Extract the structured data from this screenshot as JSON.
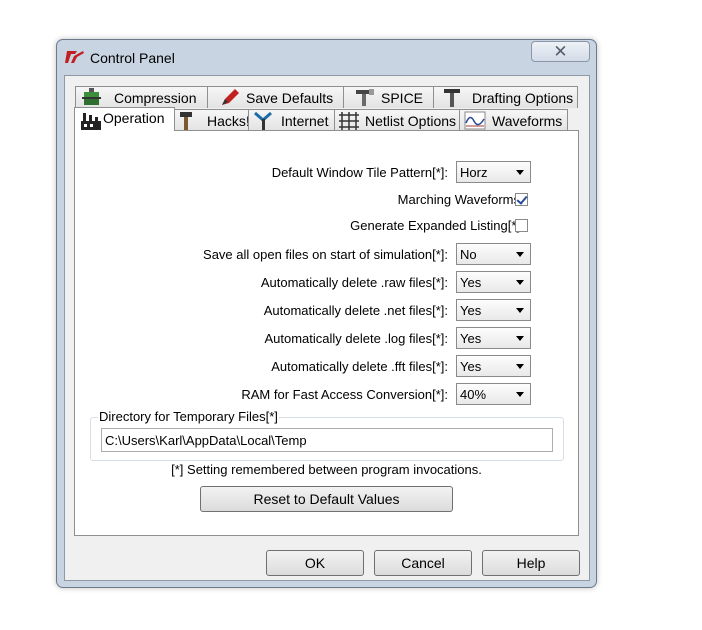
{
  "window": {
    "title": "Control Panel",
    "close_glyph": "✕",
    "app_icon": "ltspice-logo-icon"
  },
  "tabs_top": [
    {
      "label": "Compression",
      "icon": "compression-icon"
    },
    {
      "label": "Save Defaults",
      "icon": "save-pen-icon"
    },
    {
      "label": "SPICE",
      "icon": "spice-icon"
    },
    {
      "label": "Drafting Options",
      "icon": "drafting-icon"
    }
  ],
  "tabs_bottom": [
    {
      "label": "Operation",
      "icon": "factory-icon",
      "active": true
    },
    {
      "label": "Hacks!",
      "icon": "hammer-icon"
    },
    {
      "label": "Internet",
      "icon": "internet-icon"
    },
    {
      "label": "Netlist Options",
      "icon": "netlist-icon"
    },
    {
      "label": "Waveforms",
      "icon": "waveforms-icon"
    }
  ],
  "settings": {
    "tile_pattern": {
      "label": "Default Window Tile Pattern[*]:",
      "value": "Horz"
    },
    "marching_waveforms": {
      "label": "Marching Waveforms",
      "checked": true
    },
    "expanded_listing": {
      "label": "Generate Expanded Listing[*]",
      "checked": false
    },
    "save_open_files": {
      "label": "Save all open files on start of simulation[*]:",
      "value": "No"
    },
    "delete_raw": {
      "label": "Automatically delete .raw files[*]:",
      "value": "Yes"
    },
    "delete_net": {
      "label": "Automatically delete .net files[*]:",
      "value": "Yes"
    },
    "delete_log": {
      "label": "Automatically delete .log files[*]:",
      "value": "Yes"
    },
    "delete_fft": {
      "label": "Automatically delete .fft files[*]:",
      "value": "Yes"
    },
    "ram_conversion": {
      "label": "RAM for Fast Access Conversion[*]:",
      "value": "40%"
    }
  },
  "temp_dir": {
    "title": "Directory for Temporary Files[*]",
    "value": "C:\\Users\\Karl\\AppData\\Local\\Temp"
  },
  "note": "[*] Setting remembered between program invocations.",
  "reset_label": "Reset to Default Values",
  "buttons": {
    "ok": "OK",
    "cancel": "Cancel",
    "help": "Help"
  },
  "colors": {
    "accent": "#2a4a9c",
    "frame": "#c9d4e3",
    "logo_red": "#c0201f"
  }
}
